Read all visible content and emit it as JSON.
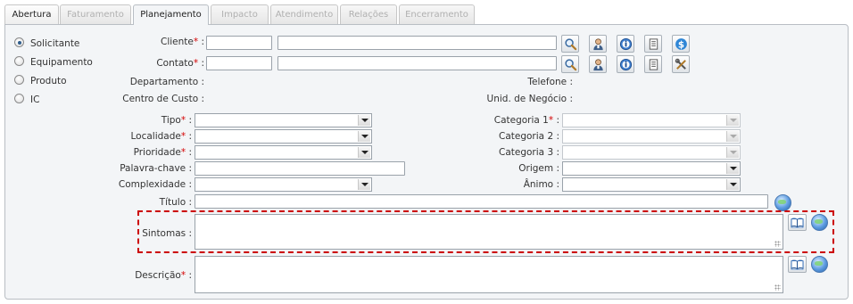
{
  "tabs": [
    {
      "label": "Abertura",
      "state": "enabled"
    },
    {
      "label": "Faturamento",
      "state": "disabled"
    },
    {
      "label": "Planejamento",
      "state": "active"
    },
    {
      "label": "Impacto",
      "state": "disabled"
    },
    {
      "label": "Atendimento",
      "state": "disabled"
    },
    {
      "label": "Relações",
      "state": "disabled"
    },
    {
      "label": "Encerramento",
      "state": "disabled"
    }
  ],
  "radio_options": [
    {
      "label": "Solicitante",
      "checked": true
    },
    {
      "label": "Equipamento",
      "checked": false
    },
    {
      "label": "Produto",
      "checked": false
    },
    {
      "label": "IC",
      "checked": false
    }
  ],
  "fields": {
    "cliente": {
      "label": "Cliente",
      "sep": ":",
      "required": "*"
    },
    "contato": {
      "label": "Contato",
      "sep": ":",
      "required": "*"
    },
    "departamento": {
      "label": "Departamento :"
    },
    "telefone": {
      "label": "Telefone :"
    },
    "centro_custo": {
      "label": "Centro de Custo :"
    },
    "unid_negocio": {
      "label": "Unid. de Negócio :"
    },
    "tipo": {
      "label": "Tipo",
      "sep": ":",
      "required": "*",
      "value": ""
    },
    "localidade": {
      "label": "Localidade",
      "sep": ":",
      "required": "*",
      "value": ""
    },
    "prioridade": {
      "label": "Prioridade",
      "sep": ":",
      "required": "*",
      "value": ""
    },
    "palavra_chave": {
      "label": "Palavra-chave :",
      "value": ""
    },
    "complexidade": {
      "label": "Complexidade :",
      "value": ""
    },
    "categoria1": {
      "label": "Categoria 1",
      "sep": ":",
      "required": "*",
      "value": ""
    },
    "categoria2": {
      "label": "Categoria 2 :",
      "value": ""
    },
    "categoria3": {
      "label": "Categoria 3 :",
      "value": ""
    },
    "origem": {
      "label": "Origem :",
      "value": ""
    },
    "animo": {
      "label": "Ânimo :",
      "value": ""
    },
    "titulo": {
      "label": "Título :",
      "value": ""
    },
    "sintomas": {
      "label": "Sintomas :",
      "value": ""
    },
    "descricao": {
      "label": "Descrição",
      "sep": ":",
      "required": "*",
      "value": ""
    }
  },
  "icons": {
    "search": "magnifier-icon",
    "person": "user-icon",
    "info": "info-icon",
    "document": "document-icon",
    "money": "dollar-icon",
    "tools": "tools-icon",
    "book": "book-icon",
    "globe": "globe-icon"
  },
  "colors": {
    "required": "#d40000",
    "highlight_border": "#cc0000",
    "panel_bg": "#f3f5f7"
  }
}
